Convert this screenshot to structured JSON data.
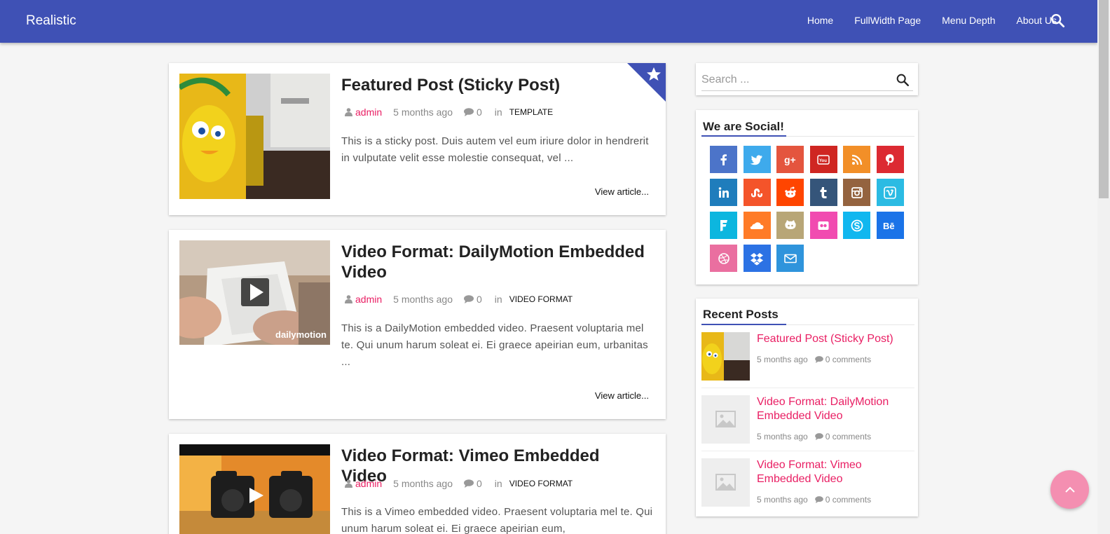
{
  "site": {
    "title": "Realistic"
  },
  "nav": {
    "items": [
      "Home",
      "FullWidth Page",
      "Menu Depth",
      "About Us"
    ]
  },
  "posts": [
    {
      "title": "Featured Post (Sticky Post)",
      "author": "admin",
      "time": "5 months ago",
      "comments": "0",
      "in": "in",
      "category": "TEMPLATE",
      "excerpt": "This is a sticky post. Duis autem vel eum iriure dolor in hendrerit in vulputate velit esse molestie consequat, vel ...",
      "more": "View article..."
    },
    {
      "title": "Video Format: DailyMotion Embedded Video",
      "author": "admin",
      "time": "5 months ago",
      "comments": "0",
      "in": "in",
      "category": "VIDEO FORMAT",
      "excerpt": "This is a DailyMotion embedded video. Praesent voluptaria mel te. Qui unum harum soleat ei. Ei graece apeirian eum, urbanitas ...",
      "more": "View article...",
      "thumb_watermark": "dailymotion"
    },
    {
      "title": "Video Format: Vimeo Embedded Video",
      "author": "admin",
      "time": "5 months ago",
      "comments": "0",
      "in": "in",
      "category": "VIDEO FORMAT",
      "excerpt": "This is a Vimeo embedded video. Praesent voluptaria mel te. Qui unum harum soleat ei. Ei graece apeirian eum,"
    }
  ],
  "sidebar": {
    "search_placeholder": "Search ...",
    "social_title": "We are Social!",
    "social": [
      {
        "name": "facebook",
        "color": "#4c74c9"
      },
      {
        "name": "twitter",
        "color": "#3eaaec"
      },
      {
        "name": "google-plus",
        "color": "#e4553e"
      },
      {
        "name": "youtube",
        "color": "#cf2622"
      },
      {
        "name": "rss",
        "color": "#f28f28"
      },
      {
        "name": "pinterest",
        "color": "#dc2a32"
      },
      {
        "name": "linkedin",
        "color": "#1f7dbc"
      },
      {
        "name": "stumbleupon",
        "color": "#f4542a"
      },
      {
        "name": "reddit",
        "color": "#ff4500"
      },
      {
        "name": "tumblr",
        "color": "#35557a"
      },
      {
        "name": "instagram",
        "color": "#94633f"
      },
      {
        "name": "vimeo",
        "color": "#2bbbe3"
      },
      {
        "name": "foursquare",
        "color": "#0cb6df"
      },
      {
        "name": "soundcloud",
        "color": "#ff7b27"
      },
      {
        "name": "github",
        "color": "#b8a677"
      },
      {
        "name": "flickr",
        "color": "#f14bb0"
      },
      {
        "name": "skype",
        "color": "#11b7ef"
      },
      {
        "name": "behance",
        "color": "#1a73e8"
      },
      {
        "name": "dribbble",
        "color": "#ea6fa0"
      },
      {
        "name": "dropbox",
        "color": "#2c72e4"
      },
      {
        "name": "email",
        "color": "#2f94dc"
      }
    ],
    "recent_title": "Recent Posts",
    "recent": [
      {
        "title": "Featured Post (Sticky Post)",
        "time": "5 months ago",
        "comments": "0 comments"
      },
      {
        "title": "Video Format: DailyMotion Embedded Video",
        "time": "5 months ago",
        "comments": "0 comments"
      },
      {
        "title": "Video Format: Vimeo Embedded Video",
        "time": "5 months ago",
        "comments": "0 comments"
      }
    ]
  },
  "colors": {
    "primary": "#3f51b5",
    "accent": "#e91e63",
    "to_top": "#f48fb1"
  }
}
